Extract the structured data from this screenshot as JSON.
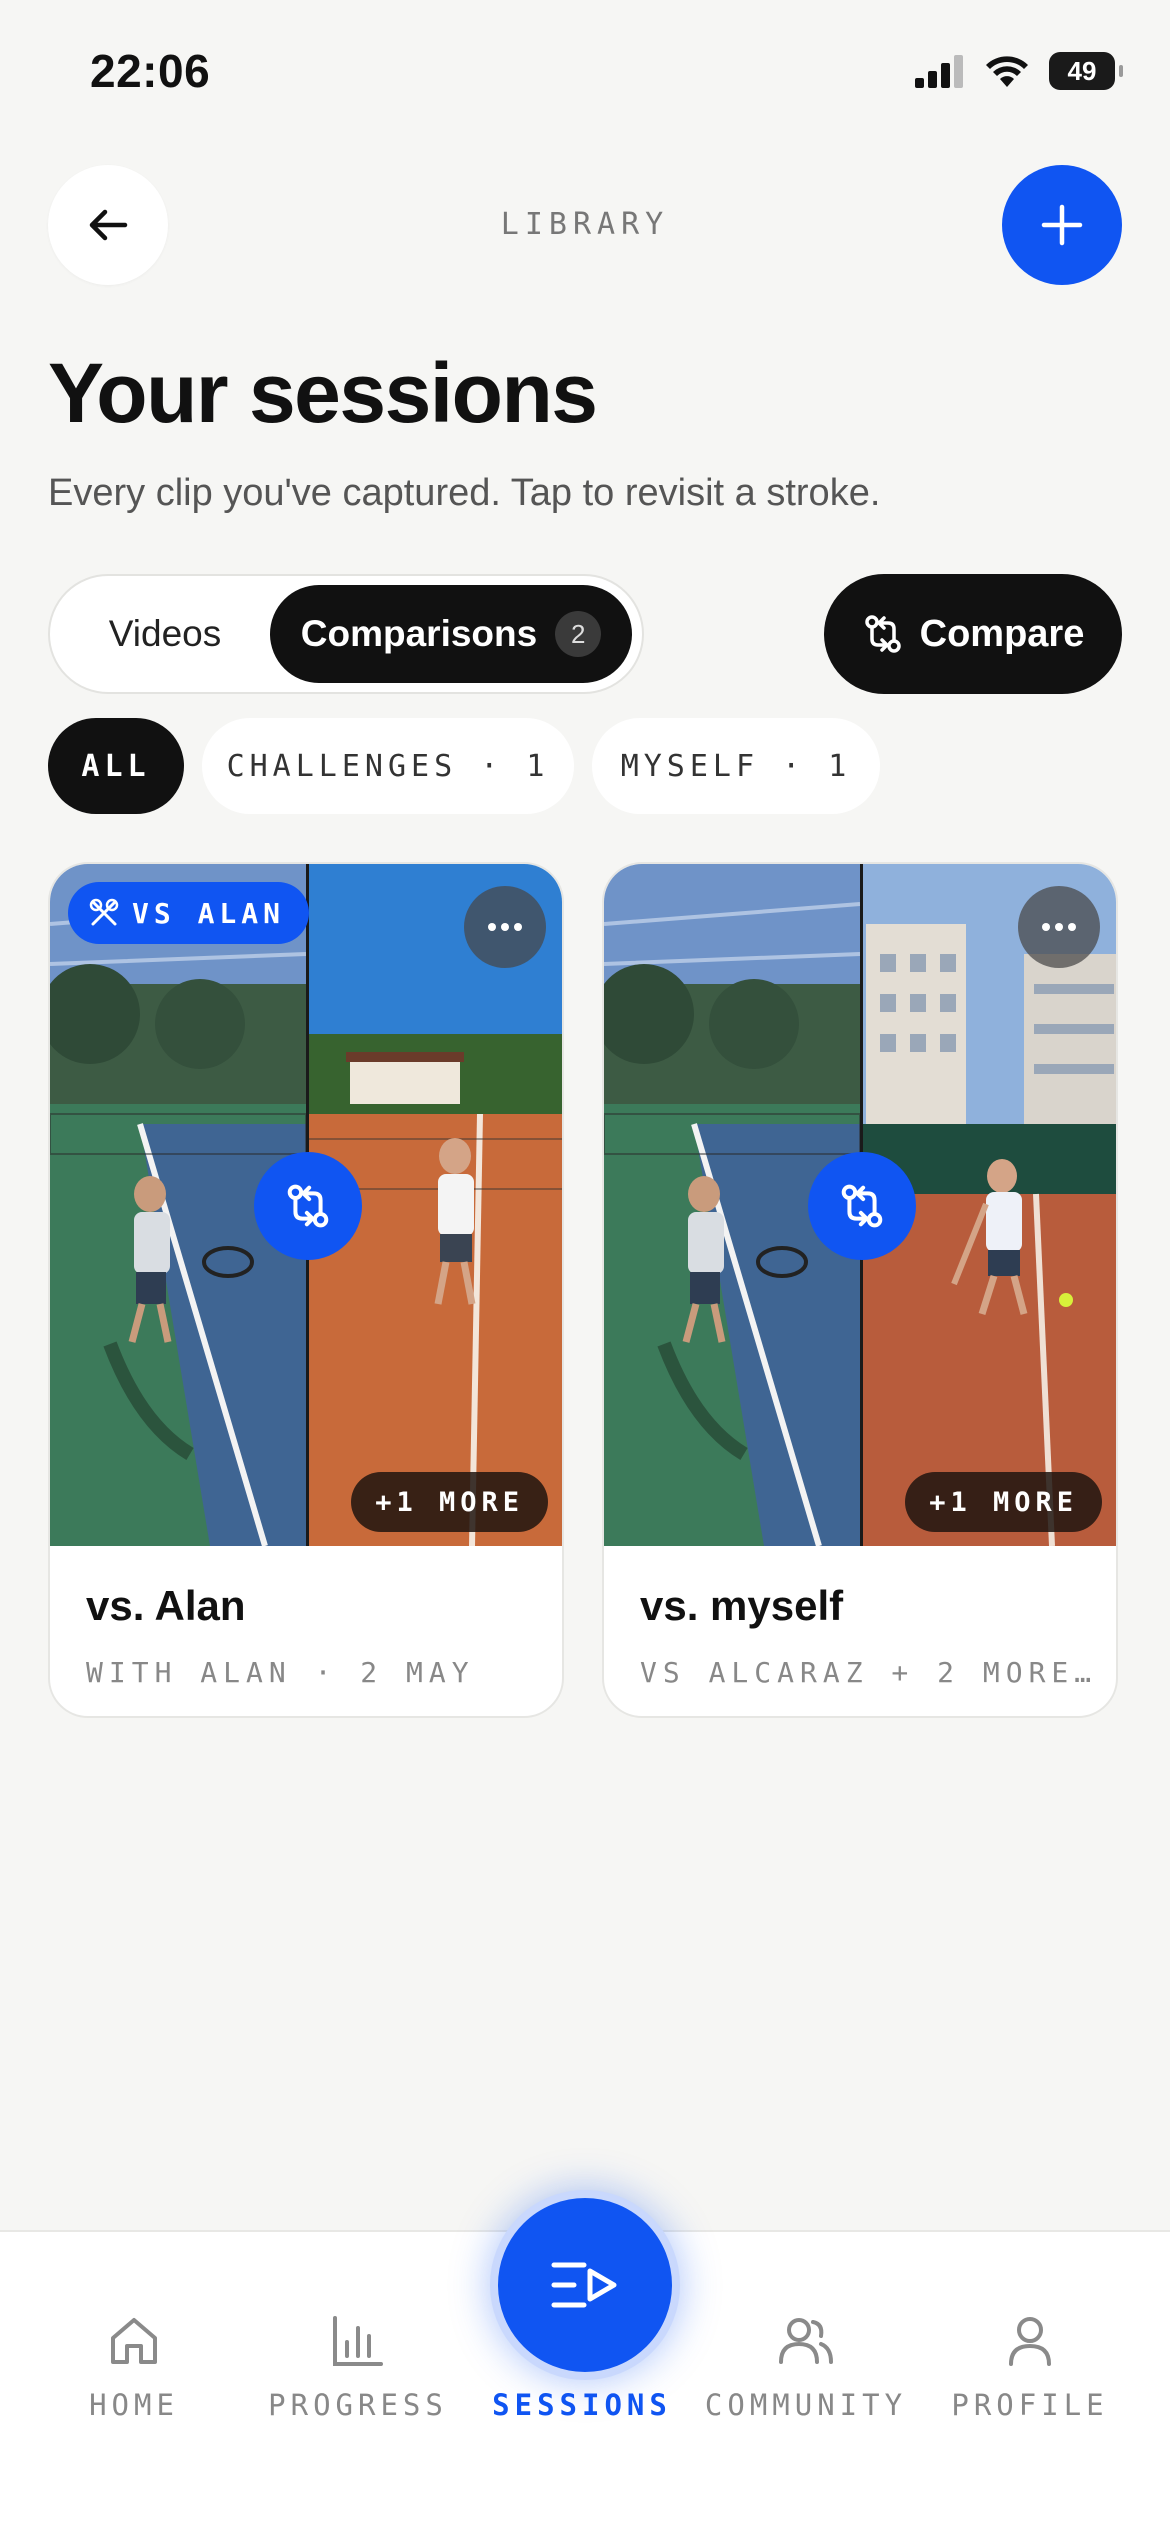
{
  "status_bar": {
    "time": "22:06",
    "battery": "49"
  },
  "header": {
    "library_label": "LIBRARY"
  },
  "page": {
    "title": "Your sessions",
    "subtitle": "Every clip you've captured. Tap to revisit a stroke."
  },
  "segmented": {
    "videos_label": "Videos",
    "comparisons_label": "Comparisons",
    "comparisons_count": "2"
  },
  "compare_button": {
    "label": "Compare"
  },
  "filters": [
    {
      "label": "ALL"
    },
    {
      "label": "CHALLENGES · 1"
    },
    {
      "label": "MYSELF · 1"
    }
  ],
  "cards": [
    {
      "badge": "VS ALAN",
      "more_pill": "+1 MORE",
      "title": "vs. Alan",
      "meta": "WITH ALAN · 2 MAY"
    },
    {
      "more_pill": "+1 MORE",
      "title": "vs. myself",
      "meta": "VS ALCARAZ + 2 MORE…"
    }
  ],
  "tabs": [
    {
      "label": "HOME",
      "icon": "home-icon"
    },
    {
      "label": "PROGRESS",
      "icon": "bar-chart-icon"
    },
    {
      "label": "SESSIONS",
      "icon": "sessions-icon"
    },
    {
      "label": "COMMUNITY",
      "icon": "community-icon"
    },
    {
      "label": "PROFILE",
      "icon": "profile-icon"
    }
  ],
  "colors": {
    "accent": "#1055f2",
    "dark": "#111111",
    "background": "#f6f6f4"
  }
}
